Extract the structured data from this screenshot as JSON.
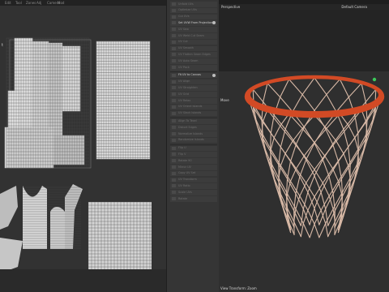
{
  "top_menu": {
    "items": [
      "Edit",
      "Tool",
      "Zones",
      "Adj",
      "Camera",
      "Mod"
    ]
  },
  "uv_panel": {
    "corner_label": "t"
  },
  "tool_panel": {
    "items": [
      {
        "label": "Unfold UVs",
        "active": false
      },
      {
        "label": "Optimize UVs",
        "active": false
      },
      {
        "label": "Cut UVs",
        "active": false
      },
      {
        "label": "Set UVW From Projection",
        "active": true
      },
      {
        "label": "UV Sew",
        "active": false
      },
      {
        "label": "UV Weld Cut Seam",
        "active": false
      },
      {
        "label": "UV Cut",
        "active": false
      },
      {
        "label": "UV Smooth",
        "active": false
      },
      {
        "label": "UV Flatten Seam Edges",
        "active": false
      },
      {
        "label": "UV Auto Seam",
        "active": false
      },
      {
        "label": "UV Pack",
        "active": false
      },
      {
        "label": "Fit UV to Canvas",
        "active": true
      },
      {
        "label": "UV Align",
        "active": false
      },
      {
        "label": "UV Straighten",
        "active": false
      },
      {
        "label": "UV Grid",
        "active": false
      },
      {
        "label": "UV Relax",
        "active": false
      },
      {
        "label": "UV Orient Islands",
        "active": false
      },
      {
        "label": "UV Stack Islands",
        "active": false
      },
      {
        "label": "Align To Texel",
        "active": false
      },
      {
        "label": "Distort Edges",
        "active": false
      },
      {
        "label": "Normalize Islands",
        "active": false
      },
      {
        "label": "Randomize Islands",
        "active": false
      },
      {
        "label": "Flip U",
        "active": false
      },
      {
        "label": "Flip V",
        "active": false
      },
      {
        "label": "Rotate 90",
        "active": false
      },
      {
        "label": "Mirror UV",
        "active": false
      },
      {
        "label": "Copy UV Set",
        "active": false
      },
      {
        "label": "UV Transform",
        "active": false
      },
      {
        "label": "UV Ratio",
        "active": false
      },
      {
        "label": "Scale UVs",
        "active": false
      },
      {
        "label": "Rotate",
        "active": false
      }
    ]
  },
  "viewport": {
    "title": "Perspective",
    "camera": "Default Camera",
    "tool": "Move",
    "status": "View Transform: Zoom",
    "rim_color": "#d24a25",
    "net_color": "#d8b9a6"
  }
}
